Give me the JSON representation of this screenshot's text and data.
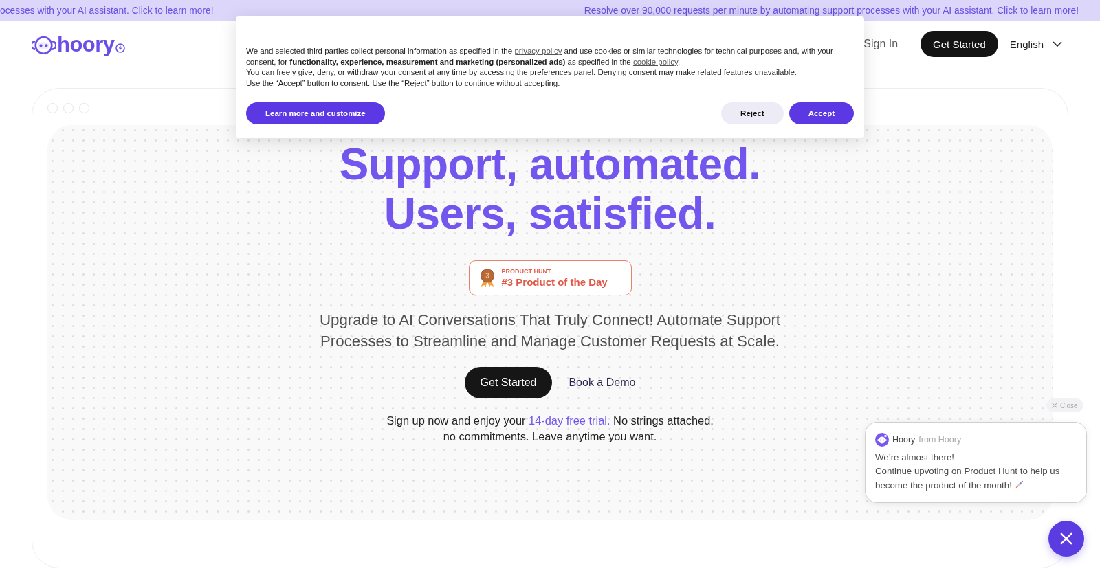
{
  "announcement_bar": {
    "texts": [
      "ocesses with your AI assistant. Click to learn more!",
      "Resolve over 90,000 requests per minute by automating support processes with your AI assistant. Click to learn more!"
    ]
  },
  "header": {
    "logo": "hoory",
    "nav": [
      {
        "kind": "link",
        "label": "Sign In"
      },
      {
        "kind": "button",
        "label": "Get Started"
      },
      {
        "kind": "dropdown",
        "label": "English"
      }
    ]
  },
  "hero": {
    "headline": [
      "Support, automated.",
      "Users, satisfied."
    ],
    "badge": {
      "rank": "3",
      "eyebrow": "PRODUCT HUNT",
      "title": "#3 Product of the Day"
    },
    "subtitle": "Upgrade to AI Conversations That Truly Connect! Automate Support Processes to Streamline and Manage Customer Requests at Scale.",
    "actions": [
      {
        "kind": "primary",
        "label": "Get Started"
      },
      {
        "kind": "link",
        "label": "Book a Demo"
      }
    ],
    "note": [
      {
        "kind": "text",
        "text": "Sign up now and enjoy your "
      },
      {
        "kind": "link",
        "text": "14-day free trial."
      },
      {
        "kind": "text",
        "text": " No strings attached, no commitments. Leave anytime you want."
      }
    ]
  },
  "cookie_dialog": {
    "paragraphs": [
      [
        {
          "kind": "text",
          "text": "We and selected third parties collect personal information as specified in the "
        },
        {
          "kind": "link",
          "text": "privacy policy"
        },
        {
          "kind": "text",
          "text": " and use cookies or similar technologies for technical purposes and, with your consent, for **functionality, experience, measurement and marketing (personalized ads)** as specified in the "
        },
        {
          "kind": "link",
          "text": "cookie policy"
        },
        {
          "kind": "text",
          "text": "."
        }
      ],
      [
        {
          "kind": "text",
          "text": "You can freely give, deny, or withdraw your consent at any time by accessing the preferences panel. Denying consent may make related features unavailable."
        }
      ],
      [
        {
          "kind": "text",
          "text": "Use the “Accept” button to consent. Use the “Reject” button to continue without accepting."
        }
      ]
    ],
    "buttons": [
      {
        "kind": "primary",
        "label": "Learn more and customize"
      },
      {
        "kind": "secondary",
        "label": "Reject"
      },
      {
        "kind": "primary",
        "label": "Accept"
      }
    ]
  },
  "chat_widget": {
    "close_label": "Close",
    "sender": "Hoory",
    "sender_meta": "from Hoory",
    "messages": [
      [
        {
          "kind": "text",
          "text": "We’re almost there!"
        }
      ],
      [
        {
          "kind": "text",
          "text": "Continue "
        },
        {
          "kind": "link",
          "text": "upvoting"
        },
        {
          "kind": "text",
          "text": " on Product Hunt to help us become the product of the month!"
        }
      ]
    ]
  }
}
